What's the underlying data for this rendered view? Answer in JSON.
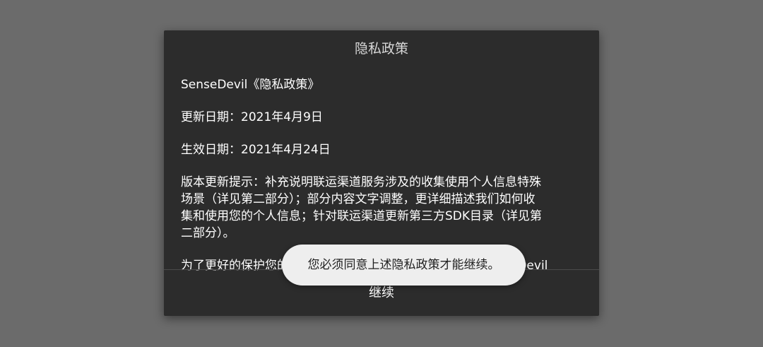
{
  "dialog": {
    "title": "隐私政策",
    "paragraphs": [
      "SenseDevil《隐私政策》",
      "更新日期：2021年4月9日",
      "生效日期：2021年4月24日",
      "版本更新提示：补充说明联运渠道服务涉及的收集使用个人信息特殊\n场景（详见第二部分）；部分内容文字调整，更详细描述我们如何收\n集和使用您的个人信息；针对联运渠道更新第三方SDK目录（详见第\n二部分）。",
      "为了更好的保护您的个人信息，建议您仔细阅读更新后的SenseDevil"
    ],
    "continue_label": "继续"
  },
  "toast": {
    "message": "您必须同意上述隐私政策才能继续。"
  },
  "colors": {
    "backdrop": "#6b6b6b",
    "dialog_bg": "#2c2c2c",
    "toast_bg": "#eeeeee"
  }
}
